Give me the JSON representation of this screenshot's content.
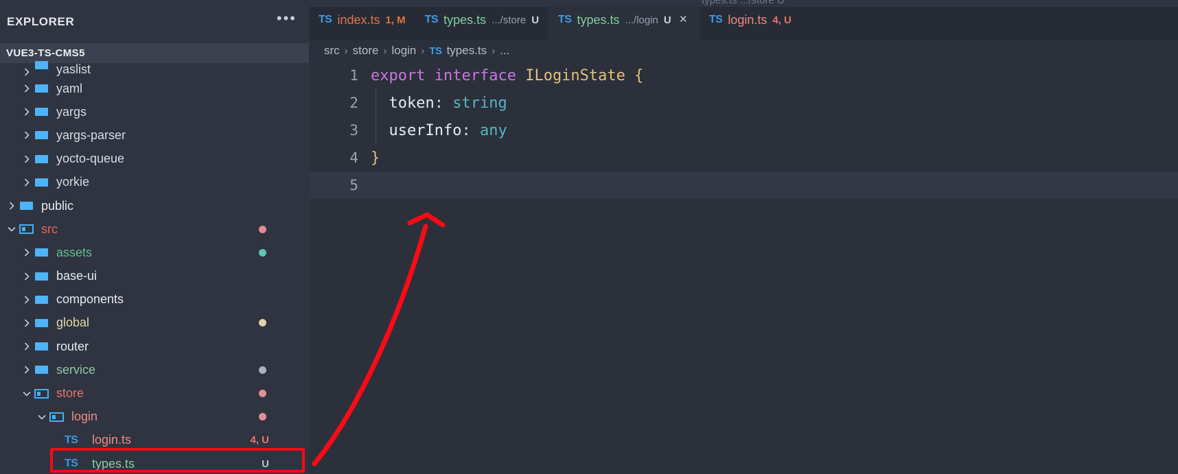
{
  "sidebar": {
    "title": "EXPLORER",
    "actions_icon": "ellipsis-icon",
    "project_root": "VUE3-TS-CMS5",
    "tree": [
      {
        "name": "yaslist",
        "type": "folder",
        "depth": 1,
        "expanded": false,
        "color": "#d6dae2",
        "badge": "",
        "badge_color": "",
        "dot": "",
        "clipped": true
      },
      {
        "name": "yaml",
        "type": "folder",
        "depth": 1,
        "expanded": false,
        "color": "#d6dae2",
        "badge": "",
        "badge_color": "",
        "dot": ""
      },
      {
        "name": "yargs",
        "type": "folder",
        "depth": 1,
        "expanded": false,
        "color": "#d6dae2",
        "badge": "",
        "badge_color": "",
        "dot": ""
      },
      {
        "name": "yargs-parser",
        "type": "folder",
        "depth": 1,
        "expanded": false,
        "color": "#d6dae2",
        "badge": "",
        "badge_color": "",
        "dot": ""
      },
      {
        "name": "yocto-queue",
        "type": "folder",
        "depth": 1,
        "expanded": false,
        "color": "#d6dae2",
        "badge": "",
        "badge_color": "",
        "dot": ""
      },
      {
        "name": "yorkie",
        "type": "folder",
        "depth": 1,
        "expanded": false,
        "color": "#d6dae2",
        "badge": "",
        "badge_color": "",
        "dot": ""
      },
      {
        "name": "public",
        "type": "folder",
        "depth": 0,
        "expanded": false,
        "color": "#e6e9ef",
        "badge": "",
        "badge_color": "",
        "dot": ""
      },
      {
        "name": "src",
        "type": "folder-open",
        "depth": 0,
        "expanded": true,
        "color": "#e06c5a",
        "badge": "",
        "badge_color": "",
        "dot": "#e08c90"
      },
      {
        "name": "assets",
        "type": "folder",
        "depth": 1,
        "expanded": false,
        "color": "#5fbf92",
        "badge": "",
        "badge_color": "",
        "dot": "#5fc3b5"
      },
      {
        "name": "base-ui",
        "type": "folder",
        "depth": 1,
        "expanded": false,
        "color": "#e6e9ef",
        "badge": "",
        "badge_color": "",
        "dot": ""
      },
      {
        "name": "components",
        "type": "folder",
        "depth": 1,
        "expanded": false,
        "color": "#e6e9ef",
        "badge": "",
        "badge_color": "",
        "dot": ""
      },
      {
        "name": "global",
        "type": "folder",
        "depth": 1,
        "expanded": false,
        "color": "#ddd5a8",
        "badge": "",
        "badge_color": "",
        "dot": "#ded0b0"
      },
      {
        "name": "router",
        "type": "folder",
        "depth": 1,
        "expanded": false,
        "color": "#e6e9ef",
        "badge": "",
        "badge_color": "",
        "dot": ""
      },
      {
        "name": "service",
        "type": "folder",
        "depth": 1,
        "expanded": false,
        "color": "#8dc6a8",
        "badge": "",
        "badge_color": "",
        "dot": "#a9b2c0"
      },
      {
        "name": "store",
        "type": "folder-open",
        "depth": 1,
        "expanded": true,
        "color": "#e8736b",
        "badge": "",
        "badge_color": "",
        "dot": "#e09094"
      },
      {
        "name": "login",
        "type": "folder-open",
        "depth": 2,
        "expanded": true,
        "color": "#ef8a83",
        "badge": "",
        "badge_color": "",
        "dot": "#e09094"
      },
      {
        "name": "login.ts",
        "type": "file-ts",
        "depth": 3,
        "expanded": false,
        "color": "#ef8a83",
        "badge": "4, U",
        "badge_color": "#e8736b",
        "dot": ""
      },
      {
        "name": "types.ts",
        "type": "file-ts",
        "depth": 3,
        "expanded": false,
        "color": "#7fcf9e",
        "badge": "U",
        "badge_color": "#b9bfcb",
        "dot": "",
        "annotated": true
      }
    ]
  },
  "tabs": [
    {
      "icon": "ts-file-icon",
      "label": "index.ts",
      "desc": "",
      "badge": "1, M",
      "badge_color": "#e0743c",
      "label_color": "#e0734a",
      "active": false,
      "closeable": false
    },
    {
      "icon": "ts-file-icon",
      "label": "types.ts",
      "desc": ".../store",
      "badge": "U",
      "badge_color": "#cfd4dd",
      "label_color": "#7fcf9e",
      "active": false,
      "closeable": false
    },
    {
      "icon": "ts-file-icon",
      "label": "types.ts",
      "desc": ".../login",
      "badge": "U",
      "badge_color": "#cfd4dd",
      "label_color": "#7fcf9e",
      "active": true,
      "closeable": true,
      "close_icon": "close-icon"
    },
    {
      "icon": "ts-file-icon",
      "label": "login.ts",
      "desc": "",
      "badge": "4, U",
      "badge_color": "#e8736b",
      "label_color": "#ef8a83",
      "active": false,
      "closeable": false
    }
  ],
  "breadcrumb": {
    "items": [
      "src",
      "store",
      "login"
    ],
    "file_icon": "ts-file-icon",
    "file": "types.ts",
    "overflow": "..."
  },
  "code": {
    "lines": [
      {
        "num": "1",
        "current": false,
        "indent_guide": false,
        "tokens": [
          {
            "t": "export",
            "c": "k-kw"
          },
          {
            "t": " ",
            "c": "k-punc"
          },
          {
            "t": "interface",
            "c": "k-kw"
          },
          {
            "t": " ",
            "c": "k-punc"
          },
          {
            "t": "ILoginState",
            "c": "k-type"
          },
          {
            "t": " ",
            "c": "k-punc"
          },
          {
            "t": "{",
            "c": "k-brace"
          }
        ]
      },
      {
        "num": "2",
        "current": false,
        "indent_guide": true,
        "tokens": [
          {
            "t": "  ",
            "c": "k-punc"
          },
          {
            "t": "token",
            "c": "k-prop"
          },
          {
            "t": ":",
            "c": "k-punc"
          },
          {
            "t": " ",
            "c": "k-punc"
          },
          {
            "t": "string",
            "c": "k-prim"
          }
        ]
      },
      {
        "num": "3",
        "current": false,
        "indent_guide": true,
        "tokens": [
          {
            "t": "  ",
            "c": "k-punc"
          },
          {
            "t": "userInfo",
            "c": "k-prop"
          },
          {
            "t": ":",
            "c": "k-punc"
          },
          {
            "t": " ",
            "c": "k-punc"
          },
          {
            "t": "any",
            "c": "k-prim"
          }
        ]
      },
      {
        "num": "4",
        "current": false,
        "indent_guide": false,
        "tokens": [
          {
            "t": "}",
            "c": "k-brace"
          }
        ]
      },
      {
        "num": "5",
        "current": true,
        "indent_guide": false,
        "tokens": []
      }
    ]
  },
  "annotations": {
    "arrow_color": "#fb0a16",
    "highlight_box_color": "#fb0a16",
    "arrow_name": "red-arrow-annotation",
    "box_name": "red-highlight-box-annotation"
  },
  "top_overlay_text": "types.ts   .../store   U"
}
